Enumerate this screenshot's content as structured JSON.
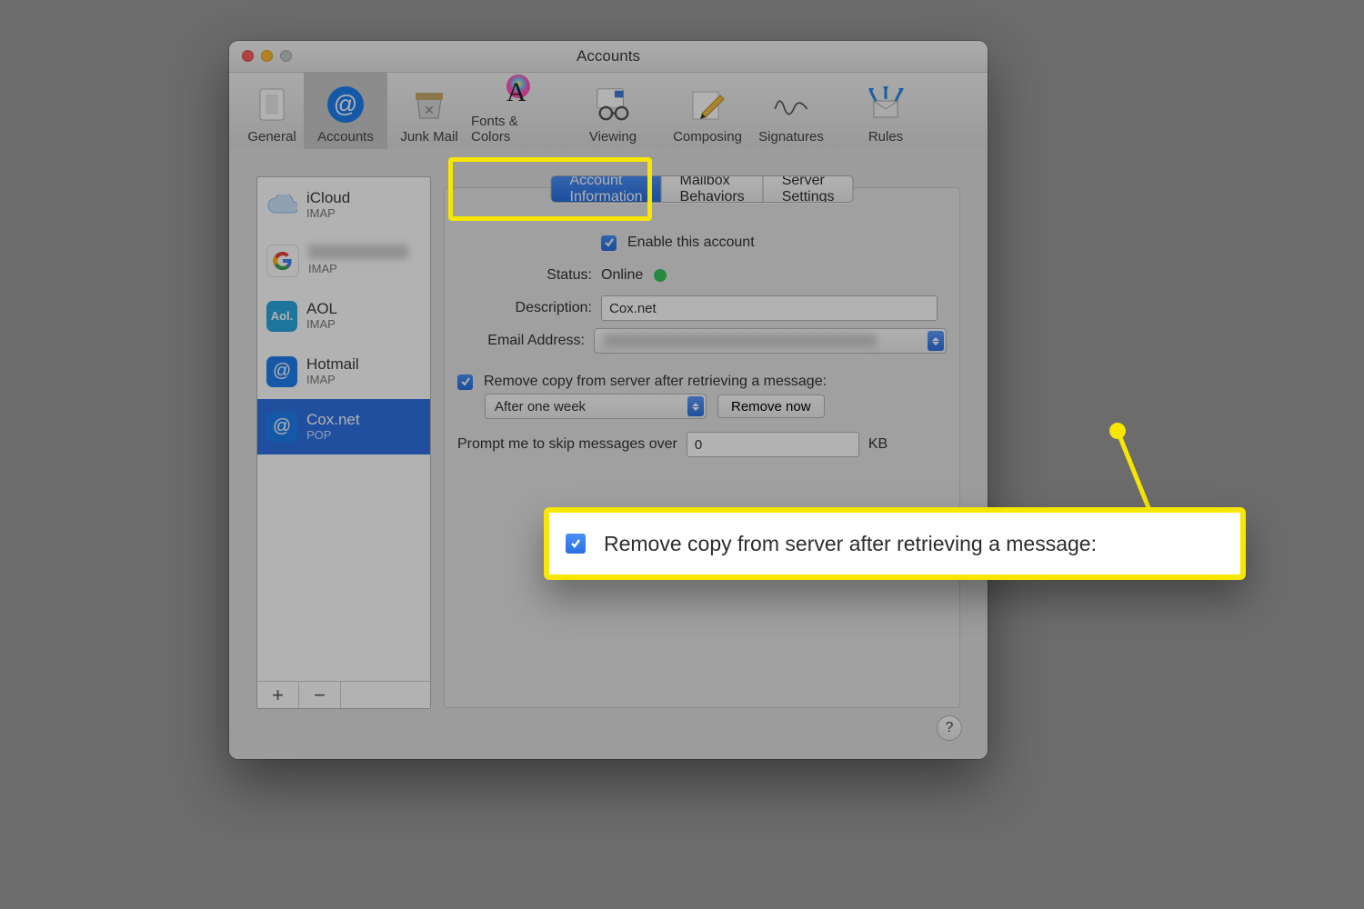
{
  "window_title": "Accounts",
  "toolbar": [
    {
      "key": "general",
      "label": "General"
    },
    {
      "key": "accounts",
      "label": "Accounts",
      "active": true
    },
    {
      "key": "junk",
      "label": "Junk Mail"
    },
    {
      "key": "fonts",
      "label": "Fonts & Colors"
    },
    {
      "key": "viewing",
      "label": "Viewing"
    },
    {
      "key": "composing",
      "label": "Composing"
    },
    {
      "key": "signatures",
      "label": "Signatures"
    },
    {
      "key": "rules",
      "label": "Rules"
    }
  ],
  "accounts": [
    {
      "name": "iCloud",
      "protocol": "IMAP"
    },
    {
      "name": "",
      "protocol": "IMAP",
      "redacted": true
    },
    {
      "name": "AOL",
      "protocol": "IMAP"
    },
    {
      "name": "Hotmail",
      "protocol": "IMAP"
    },
    {
      "name": "Cox.net",
      "protocol": "POP",
      "selected": true
    }
  ],
  "tabs": {
    "account_info": "Account Information",
    "mailbox_behaviors": "Mailbox Behaviors",
    "server_settings": "Server Settings",
    "active": "account_info"
  },
  "form": {
    "enable_label": "Enable this account",
    "enable_checked": true,
    "status_label": "Status:",
    "status_value": "Online",
    "description_label": "Description:",
    "description_value": "Cox.net",
    "email_label": "Email Address:",
    "remove_label": "Remove copy from server after retrieving a message:",
    "remove_checked": true,
    "remove_after_value": "After one week",
    "remove_now_label": "Remove now",
    "skip_label": "Prompt me to skip messages over",
    "skip_value": "0",
    "skip_unit": "KB"
  },
  "callout_text": "Remove copy from server after retrieving a message:",
  "help": "?",
  "add": "+",
  "remove": "−"
}
